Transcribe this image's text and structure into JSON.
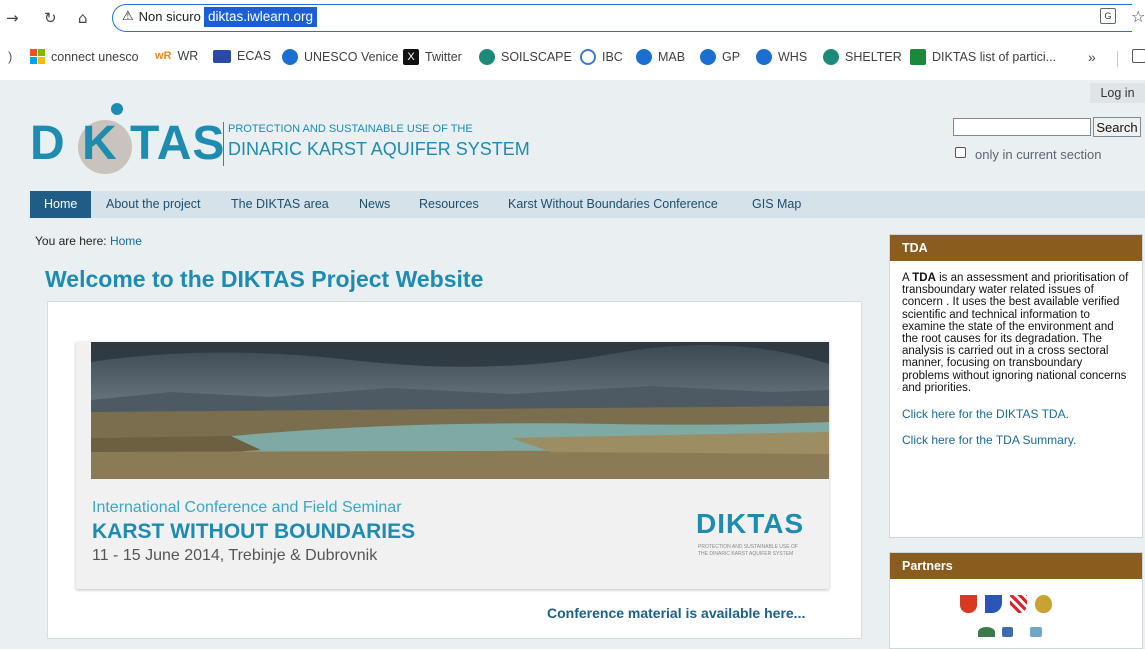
{
  "browser": {
    "address_warning": "Non sicuro",
    "url": "diktas.iwlearn.org",
    "bookmarks": [
      {
        "label": "connect unesco",
        "icon": "microsoft-icon",
        "color": "#f25022"
      },
      {
        "label": "WR",
        "icon": "wr-icon",
        "color": "#e88a1a"
      },
      {
        "label": "ECAS",
        "icon": "eu-flag-icon",
        "color": "#2a4aa8"
      },
      {
        "label": "UNESCO Venice",
        "icon": "globe-icon",
        "color": "#1a6fd0"
      },
      {
        "label": "Twitter",
        "icon": "x-logo-icon",
        "color": "#111111"
      },
      {
        "label": "SOILSCAPE",
        "icon": "soilscape-icon",
        "color": "#1a8a7a"
      },
      {
        "label": "IBC",
        "icon": "un-icon",
        "color": "#3a7ad0"
      },
      {
        "label": "MAB",
        "icon": "globe-icon",
        "color": "#1a6fd0"
      },
      {
        "label": "GP",
        "icon": "globe-icon",
        "color": "#1a6fd0"
      },
      {
        "label": "WHS",
        "icon": "globe-icon",
        "color": "#1a6fd0"
      },
      {
        "label": "SHELTER",
        "icon": "soilscape-icon",
        "color": "#1a8a7a"
      },
      {
        "label": "DIKTAS list of partici...",
        "icon": "sheets-icon",
        "color": "#1a8a3a"
      }
    ],
    "overflow": "»"
  },
  "site": {
    "login": "Log in",
    "logo_d": "D",
    "logo_k": "K",
    "logo_tas": "TAS",
    "logo_tagline1": "PROTECTION AND SUSTAINABLE USE OF THE",
    "logo_tagline2": "DINARIC KARST AQUIFER SYSTEM",
    "search_button": "Search",
    "search_value": "",
    "current_section_label": "only in current section",
    "nav": [
      "Home",
      "About the project",
      "The DIKTAS area",
      "News",
      "Resources",
      "Karst Without Boundaries Conference",
      "GIS Map"
    ],
    "breadcrumb_prefix": "You are here:",
    "breadcrumb_link": "Home",
    "page_title": "Welcome to the DIKTAS Project Website",
    "banner": {
      "line1": "International Conference and Field Seminar",
      "line2": "KARST WITHOUT BOUNDARIES",
      "line3": "11 - 15 June 2014, Trebinje & Dubrovnik",
      "logo_text": "DIKTAS",
      "logo_small1": "PROTECTION AND SUSTAINABLE USE OF",
      "logo_small2": "THE DINARIC KARST AQUIFER SYSTEM"
    },
    "conference_link": "Conference material is available here...",
    "tda": {
      "title": "TDA",
      "body_prefix": "A ",
      "body_bold": "TDA",
      "body_rest": " is an assessment and prioritisation of transboundary water related issues of concern . It uses the best available verified scientific and technical information to examine the state of the environment and the root causes for its degradation. The analysis is carried out in a cross sectoral manner, focusing on transboundary problems without ignoring national concerns and priorities.",
      "link1": "Click here for the DIKTAS TDA.",
      "link2": "Click here for the TDA Summary."
    },
    "partners_title": "Partners"
  }
}
